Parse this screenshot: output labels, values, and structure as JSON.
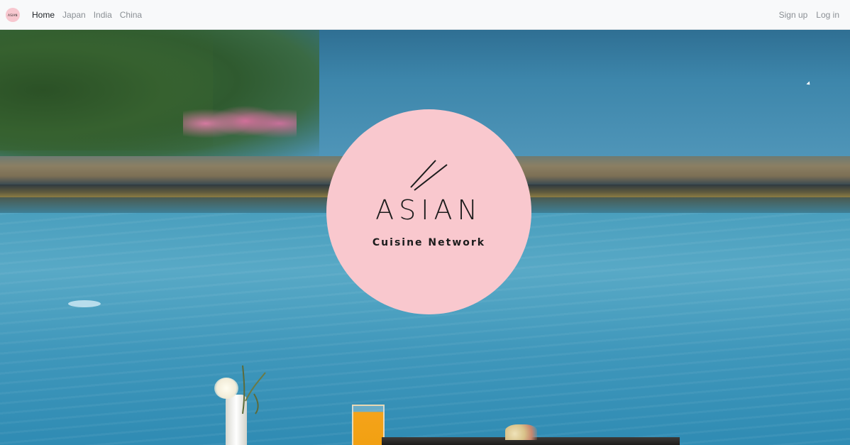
{
  "navbar": {
    "brand_mini_text": "ASIAN",
    "links": [
      {
        "label": "Home",
        "active": true
      },
      {
        "label": "Japan",
        "active": false
      },
      {
        "label": "India",
        "active": false
      },
      {
        "label": "China",
        "active": false
      }
    ],
    "right_links": [
      {
        "label": "Sign up"
      },
      {
        "label": "Log in"
      }
    ]
  },
  "hero": {
    "logo": {
      "title": "ASIAN",
      "subtitle": "Cuisine Network",
      "icon": "chopsticks-icon",
      "circle_color": "#f9c8ce"
    }
  },
  "colors": {
    "navbar_bg": "#f8f9fa",
    "link_active": "#212529",
    "link_muted": "#8a8f94",
    "logo_text": "#1c1c1c"
  }
}
